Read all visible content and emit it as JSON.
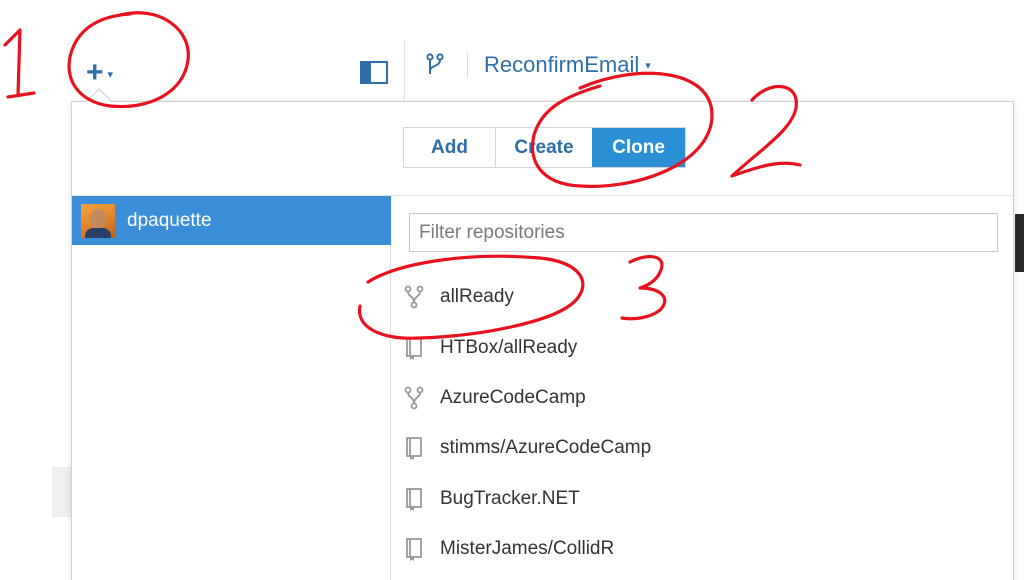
{
  "toolbar": {
    "add_icon": "plus-icon",
    "add_caret": "▾",
    "branch_name": "ReconfirmEmail",
    "branch_caret": "▾"
  },
  "popup": {
    "tabs": [
      {
        "label": "Add",
        "selected": false
      },
      {
        "label": "Create",
        "selected": false
      },
      {
        "label": "Clone",
        "selected": true
      }
    ],
    "account": {
      "name": "dpaquette",
      "selected": true
    },
    "filter": {
      "placeholder": "Filter repositories",
      "value": ""
    },
    "repos": [
      {
        "name": "allReady",
        "icon": "fork-icon"
      },
      {
        "name": "HTBox/allReady",
        "icon": "repo-icon"
      },
      {
        "name": "AzureCodeCamp",
        "icon": "fork-icon"
      },
      {
        "name": "stimms/AzureCodeCamp",
        "icon": "repo-icon"
      },
      {
        "name": "BugTracker.NET",
        "icon": "repo-icon"
      },
      {
        "name": "MisterJames/CollidR",
        "icon": "repo-icon"
      }
    ]
  },
  "annotations": {
    "color": "#e8121f",
    "labels": [
      "1",
      "2",
      "3"
    ]
  },
  "colors": {
    "accent": "#2e6ea8",
    "selected_tab": "#2b8fd6",
    "selected_account": "#3b8fd9"
  }
}
